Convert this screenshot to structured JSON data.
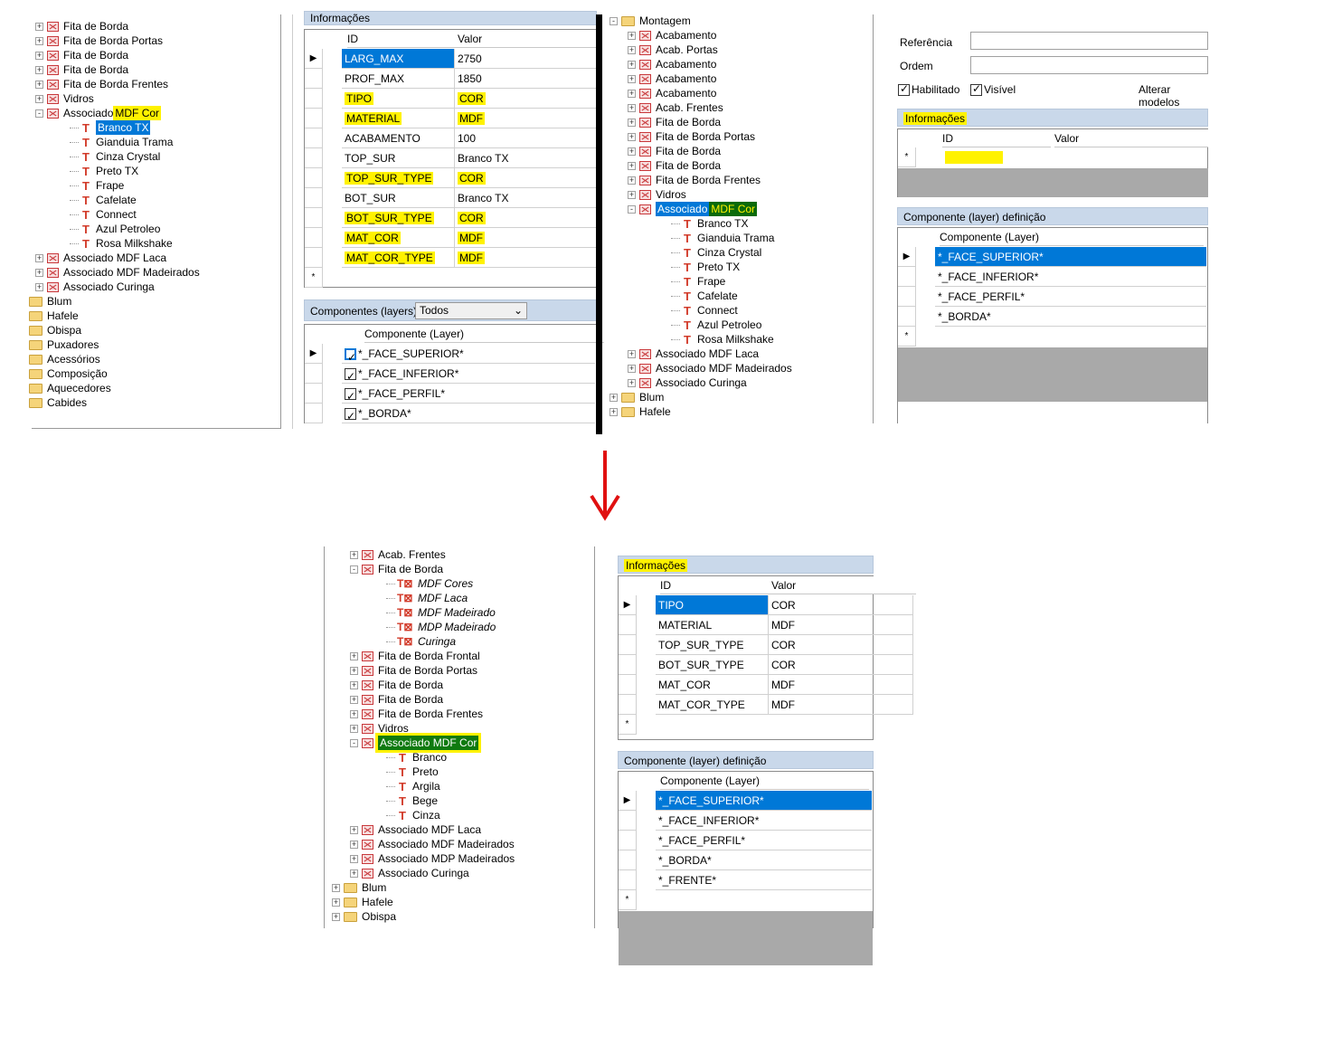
{
  "arrow_color": "#e01010",
  "shot1": {
    "tree": [
      {
        "label": "Fita de Borda",
        "icon": "mdf-icon",
        "exp": "+"
      },
      {
        "label": "Fita de Borda Portas",
        "icon": "mdf-icon",
        "exp": "+"
      },
      {
        "label": "Fita de Borda",
        "icon": "mdf-icon",
        "exp": "+"
      },
      {
        "label": "Fita de Borda",
        "icon": "mdf-icon",
        "exp": "+"
      },
      {
        "label": "Fita de Borda Frentes",
        "icon": "mdf-icon",
        "exp": "+"
      },
      {
        "label": "Vidros",
        "icon": "mdf-icon",
        "exp": "+"
      },
      {
        "label": "Associado ",
        "label2": "MDF Cor",
        "icon": "mdf-icon",
        "exp": "-"
      },
      {
        "label": "Branco TX",
        "icon": "t-icon",
        "child": true,
        "sel": true
      },
      {
        "label": "Gianduia Trama",
        "icon": "t-icon",
        "child": true
      },
      {
        "label": "Cinza Crystal",
        "icon": "t-icon",
        "child": true
      },
      {
        "label": "Preto TX",
        "icon": "t-icon",
        "child": true
      },
      {
        "label": "Frape",
        "icon": "t-icon",
        "child": true
      },
      {
        "label": "Cafelate",
        "icon": "t-icon",
        "child": true
      },
      {
        "label": "Connect",
        "icon": "t-icon",
        "child": true
      },
      {
        "label": "Azul Petroleo",
        "icon": "t-icon",
        "child": true
      },
      {
        "label": "Rosa Milkshake",
        "icon": "t-icon",
        "child": true
      },
      {
        "label": "Associado MDF Laca",
        "icon": "mdf-icon",
        "exp": "+"
      },
      {
        "label": "Associado MDF Madeirados",
        "icon": "mdf-icon",
        "exp": "+"
      },
      {
        "label": "Associado Curinga",
        "icon": "mdf-icon",
        "exp": "+"
      },
      {
        "label": "Blum",
        "icon": "folder-icon",
        "root": true
      },
      {
        "label": "Hafele",
        "icon": "folder-icon",
        "root": true
      },
      {
        "label": "Obispa",
        "icon": "folder-icon",
        "root": true
      },
      {
        "label": "Puxadores",
        "icon": "folder-icon",
        "root": true
      },
      {
        "label": "Acessórios",
        "icon": "folder-icon",
        "root": true
      },
      {
        "label": "Composição",
        "icon": "folder-icon",
        "root": true
      },
      {
        "label": "Aquecedores",
        "icon": "folder-icon",
        "root": true
      },
      {
        "label": "Cabides",
        "icon": "folder-icon",
        "root": true
      }
    ],
    "info_title": "Informações",
    "info_cols": [
      "ID",
      "Valor"
    ],
    "info_rows": [
      {
        "id": "LARG_MAX",
        "val": "2750",
        "sel": true
      },
      {
        "id": "PROF_MAX",
        "val": "1850"
      },
      {
        "id": "TIPO",
        "val": "COR",
        "hl": true
      },
      {
        "id": "MATERIAL",
        "val": "MDF",
        "hl": true
      },
      {
        "id": "ACABAMENTO",
        "val": "100"
      },
      {
        "id": "TOP_SUR",
        "val": "Branco TX"
      },
      {
        "id": "TOP_SUR_TYPE",
        "val": "COR",
        "hl": true
      },
      {
        "id": "BOT_SUR",
        "val": "Branco TX"
      },
      {
        "id": "BOT_SUR_TYPE",
        "val": "COR",
        "hl": true
      },
      {
        "id": "MAT_COR",
        "val": "MDF",
        "hl": true
      },
      {
        "id": "MAT_COR_TYPE",
        "val": "MDF",
        "hl": true
      }
    ],
    "comp_title": "Componentes (layers)",
    "comp_filter": "Todos",
    "comp_col": "Componente (Layer)",
    "comp_rows": [
      "*_FACE_SUPERIOR*",
      "*_FACE_INFERIOR*",
      "*_FACE_PERFIL*",
      "*_BORDA*"
    ]
  },
  "shot2": {
    "tree": [
      {
        "label": "Montagem",
        "icon": "folder-icon",
        "exp": "-",
        "root": true
      },
      {
        "label": "Acabamento",
        "icon": "mdf-icon",
        "exp": "+"
      },
      {
        "label": "Acab. Portas",
        "icon": "mdf-icon",
        "exp": "+"
      },
      {
        "label": "Acabamento",
        "icon": "mdf-icon",
        "exp": "+"
      },
      {
        "label": "Acabamento",
        "icon": "mdf-icon",
        "exp": "+"
      },
      {
        "label": "Acabamento",
        "icon": "mdf-icon",
        "exp": "+"
      },
      {
        "label": "Acab. Frentes",
        "icon": "mdf-icon",
        "exp": "+"
      },
      {
        "label": "Fita de Borda",
        "icon": "mdf-icon",
        "exp": "+"
      },
      {
        "label": "Fita de Borda Portas",
        "icon": "mdf-icon",
        "exp": "+"
      },
      {
        "label": "Fita de Borda",
        "icon": "mdf-icon",
        "exp": "+"
      },
      {
        "label": "Fita de Borda",
        "icon": "mdf-icon",
        "exp": "+"
      },
      {
        "label": "Fita de Borda Frentes",
        "icon": "mdf-icon",
        "exp": "+"
      },
      {
        "label": "Vidros",
        "icon": "mdf-icon",
        "exp": "+"
      },
      {
        "label": "Associado ",
        "label2": "MDF Cor",
        "icon": "mdf-icon",
        "exp": "-",
        "selg": true
      },
      {
        "label": "Branco TX",
        "icon": "t-icon",
        "child": true
      },
      {
        "label": "Gianduia Trama",
        "icon": "t-icon",
        "child": true
      },
      {
        "label": "Cinza Crystal",
        "icon": "t-icon",
        "child": true
      },
      {
        "label": "Preto TX",
        "icon": "t-icon",
        "child": true
      },
      {
        "label": "Frape",
        "icon": "t-icon",
        "child": true
      },
      {
        "label": "Cafelate",
        "icon": "t-icon",
        "child": true
      },
      {
        "label": "Connect",
        "icon": "t-icon",
        "child": true
      },
      {
        "label": "Azul Petroleo",
        "icon": "t-icon",
        "child": true
      },
      {
        "label": "Rosa Milkshake",
        "icon": "t-icon",
        "child": true
      },
      {
        "label": "Associado MDF Laca",
        "icon": "mdf-icon",
        "exp": "+"
      },
      {
        "label": "Associado MDF Madeirados",
        "icon": "mdf-icon",
        "exp": "+"
      },
      {
        "label": "Associado Curinga",
        "icon": "mdf-icon",
        "exp": "+"
      },
      {
        "label": "Blum",
        "icon": "folder-icon",
        "exp": "+",
        "root": true
      },
      {
        "label": "Hafele",
        "icon": "folder-icon",
        "exp": "+",
        "root": true
      }
    ],
    "ref_label": "Referência",
    "ordem_label": "Ordem",
    "habilitado_label": "Habilitado",
    "visivel_label": "Visível",
    "alterar_label": "Alterar modelos",
    "info_title": "Informações",
    "info_cols": [
      "ID",
      "Valor"
    ],
    "def_title": "Componente (layer) definição",
    "def_col": "Componente (Layer)",
    "def_rows": [
      "*_FACE_SUPERIOR*",
      "*_FACE_INFERIOR*",
      "*_FACE_PERFIL*",
      "*_BORDA*"
    ]
  },
  "shot3": {
    "tree": [
      {
        "label": "Acab. Frentes",
        "icon": "mdf-icon",
        "exp": "+"
      },
      {
        "label": "Fita de Borda",
        "icon": "mdf-icon",
        "exp": "-"
      },
      {
        "label": "MDF Cores",
        "icon": "t2-icon",
        "child": true,
        "ital": true
      },
      {
        "label": "MDF Laca",
        "icon": "t2-icon",
        "child": true,
        "ital": true
      },
      {
        "label": "MDF Madeirado",
        "icon": "t2-icon",
        "child": true,
        "ital": true
      },
      {
        "label": "MDP Madeirado",
        "icon": "t2-icon",
        "child": true,
        "ital": true
      },
      {
        "label": "Curinga",
        "icon": "t2-icon",
        "child": true,
        "ital": true
      },
      {
        "label": "Fita de Borda Frontal",
        "icon": "mdf-icon",
        "exp": "+"
      },
      {
        "label": "Fita de Borda Portas",
        "icon": "mdf-icon",
        "exp": "+"
      },
      {
        "label": "Fita de Borda",
        "icon": "mdf-icon",
        "exp": "+"
      },
      {
        "label": "Fita de Borda",
        "icon": "mdf-icon",
        "exp": "+"
      },
      {
        "label": "Fita de Borda Frentes",
        "icon": "mdf-icon",
        "exp": "+"
      },
      {
        "label": "Vidros",
        "icon": "mdf-icon",
        "exp": "+"
      },
      {
        "label": "Associado MDF Cor",
        "icon": "mdf-icon",
        "exp": "-",
        "green": true
      },
      {
        "label": "Branco",
        "icon": "t-icon",
        "child": true
      },
      {
        "label": "Preto",
        "icon": "t-icon",
        "child": true
      },
      {
        "label": "Argila",
        "icon": "t-icon",
        "child": true
      },
      {
        "label": "Bege",
        "icon": "t-icon",
        "child": true
      },
      {
        "label": "Cinza",
        "icon": "t-icon",
        "child": true
      },
      {
        "label": "Associado MDF Laca",
        "icon": "mdf-icon",
        "exp": "+"
      },
      {
        "label": "Associado MDF Madeirados",
        "icon": "mdf-icon",
        "exp": "+"
      },
      {
        "label": "Associado MDP Madeirados",
        "icon": "mdf-icon",
        "exp": "+"
      },
      {
        "label": "Associado Curinga",
        "icon": "mdf-icon",
        "exp": "+"
      },
      {
        "label": "Blum",
        "icon": "folder-icon",
        "exp": "+",
        "root": true
      },
      {
        "label": "Hafele",
        "icon": "folder-icon",
        "exp": "+",
        "root": true
      },
      {
        "label": "Obispa",
        "icon": "folder-icon",
        "exp": "+",
        "root": true
      }
    ],
    "info_title": "Informações",
    "info_cols": [
      "ID",
      "Valor"
    ],
    "info_rows": [
      {
        "id": "TIPO",
        "val": "COR",
        "sel": true
      },
      {
        "id": "MATERIAL",
        "val": "MDF"
      },
      {
        "id": "TOP_SUR_TYPE",
        "val": "COR"
      },
      {
        "id": "BOT_SUR_TYPE",
        "val": "COR"
      },
      {
        "id": "MAT_COR",
        "val": "MDF"
      },
      {
        "id": "MAT_COR_TYPE",
        "val": "MDF"
      }
    ],
    "def_title": "Componente (layer) definição",
    "def_col": "Componente (Layer)",
    "def_rows": [
      "*_FACE_SUPERIOR*",
      "*_FACE_INFERIOR*",
      "*_FACE_PERFIL*",
      "*_BORDA*",
      "*_FRENTE*"
    ]
  }
}
